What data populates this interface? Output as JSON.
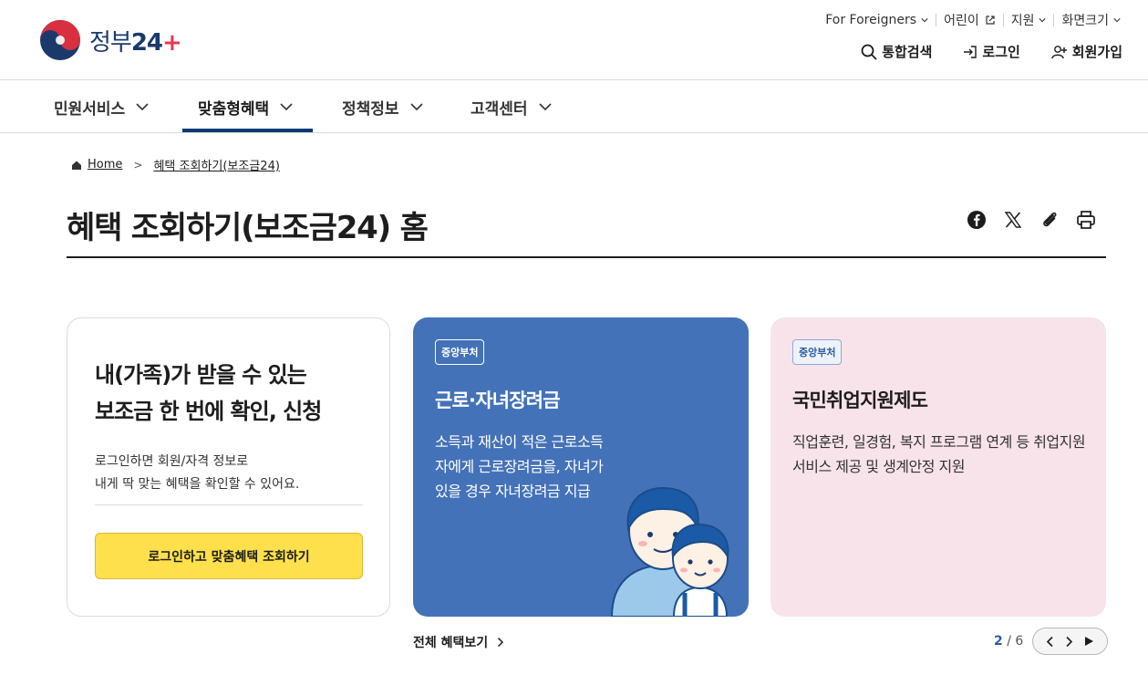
{
  "header": {
    "logo_text": "정부",
    "logo_number": "24",
    "utility": [
      {
        "label": "For Foreigners",
        "icon": "chevron-down-icon"
      },
      {
        "label": "어린이",
        "icon": "external-link-icon"
      },
      {
        "label": "지원",
        "icon": "chevron-down-icon"
      },
      {
        "label": "화면크기",
        "icon": "chevron-down-icon"
      }
    ],
    "actions": {
      "search": "통합검색",
      "login": "로그인",
      "signup": "회원가입"
    }
  },
  "gnb": {
    "items": [
      {
        "label": "민원서비스"
      },
      {
        "label": "맞춤형혜택",
        "active": true
      },
      {
        "label": "정책정보"
      },
      {
        "label": "고객센터"
      }
    ]
  },
  "breadcrumb": {
    "home": "Home",
    "current": "혜택 조회하기(보조금24)"
  },
  "page": {
    "title": "혜택 조회하기(보조금24) 홈",
    "share_icons": [
      "facebook-icon",
      "x-icon",
      "link-icon",
      "print-icon"
    ]
  },
  "login_card": {
    "title_line1": "내(가족)가 받을 수 있는",
    "title_line2": "보조금 한 번에 확인, 신청",
    "desc_line1": "로그인하면 회원/자격 정보로",
    "desc_line2": "내게 딱 맞는 혜택을 확인할 수 있어요.",
    "button": "로그인하고 맞춤혜택 조회하기"
  },
  "cards": [
    {
      "badge": "중앙부처",
      "title": "근로·자녀장려금",
      "desc": "소득과 재산이 적은 근로소득자에게 근로장려금을, 자녀가 있을 경우 자녀장려금 지급",
      "bg": "#4472b8"
    },
    {
      "badge": "중앙부처",
      "title": "국민취업지원제도",
      "desc": "직업훈련, 일경험, 복지 프로그램 연계 등 취업지원서비스 제공 및 생계안정 지원",
      "bg": "#f8e3ea"
    }
  ],
  "footer": {
    "all_benefits": "전체 혜택보기",
    "pager_current": "2",
    "pager_sep": " / ",
    "pager_total": "6"
  }
}
